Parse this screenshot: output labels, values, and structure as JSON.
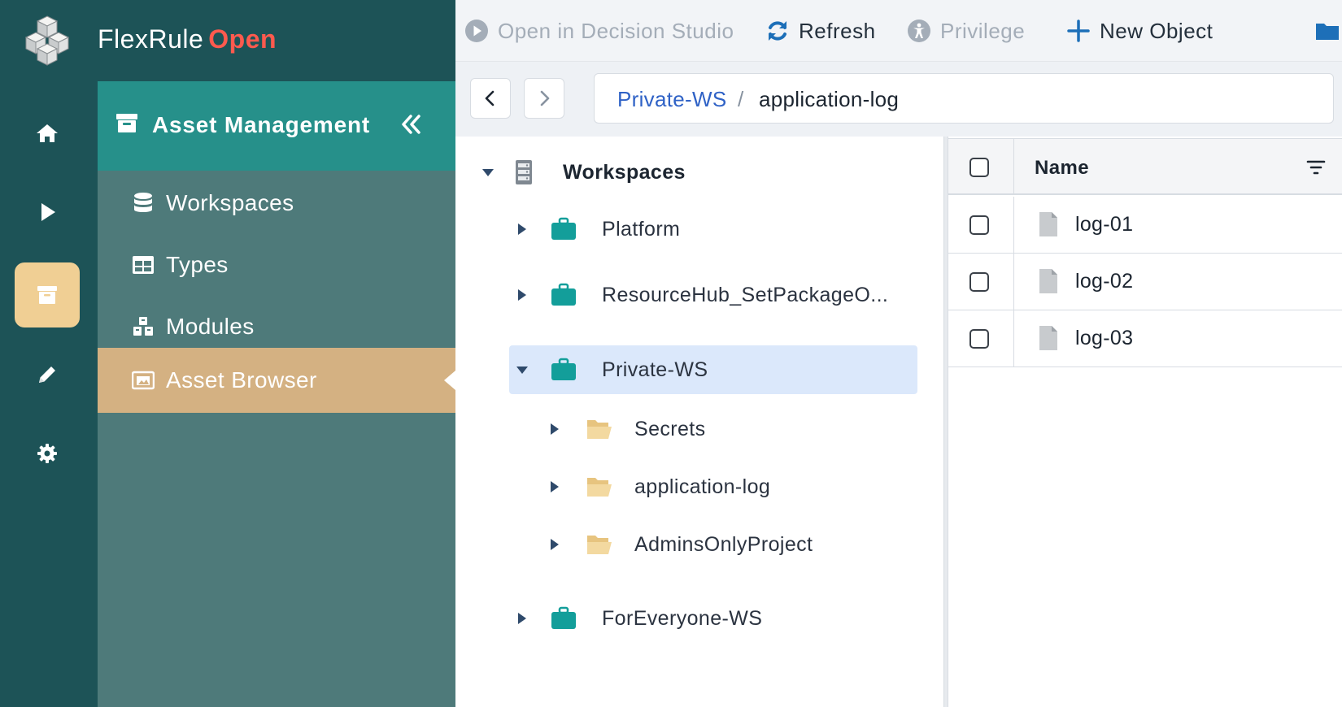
{
  "app": {
    "brand_name": "FlexRule",
    "brand_accent": "Open",
    "accent_color": "#ff5a4e"
  },
  "rail": {
    "items": [
      {
        "icon": "home-icon",
        "active": false
      },
      {
        "icon": "play-icon",
        "active": false
      },
      {
        "icon": "archive-icon",
        "active": true
      },
      {
        "icon": "pencil-icon",
        "active": false
      },
      {
        "icon": "gear-icon",
        "active": false
      }
    ]
  },
  "side_menu": {
    "title": "Asset Management",
    "items": [
      {
        "label": "Workspaces",
        "icon": "database-icon",
        "active": false
      },
      {
        "label": "Types",
        "icon": "table-icon",
        "active": false
      },
      {
        "label": "Modules",
        "icon": "cubes-icon",
        "active": false
      },
      {
        "label": "Asset Browser",
        "icon": "image-browser-icon",
        "active": true
      }
    ]
  },
  "toolbar": {
    "open_studio": "Open in Decision Studio",
    "refresh": "Refresh",
    "privilege": "Privilege",
    "new_object": "New Object"
  },
  "breadcrumb": {
    "parent": "Private-WS",
    "separator": "/",
    "current": "application-log"
  },
  "tree": {
    "root": "Workspaces",
    "nodes": [
      {
        "label": "Platform",
        "type": "workspace",
        "expanded": false
      },
      {
        "label": "ResourceHub_SetPackageO...",
        "type": "workspace",
        "expanded": false
      },
      {
        "label": "Private-WS",
        "type": "workspace",
        "expanded": true,
        "selected": true
      },
      {
        "label": "Secrets",
        "type": "folder",
        "expanded": false
      },
      {
        "label": "application-log",
        "type": "folder",
        "expanded": false
      },
      {
        "label": "AdminsOnlyProject",
        "type": "folder",
        "expanded": false
      },
      {
        "label": "ForEveryone-WS",
        "type": "workspace",
        "expanded": false
      }
    ]
  },
  "grid": {
    "column_name": "Name",
    "rows": [
      {
        "name": "log-01"
      },
      {
        "name": "log-02"
      },
      {
        "name": "log-03"
      }
    ]
  }
}
